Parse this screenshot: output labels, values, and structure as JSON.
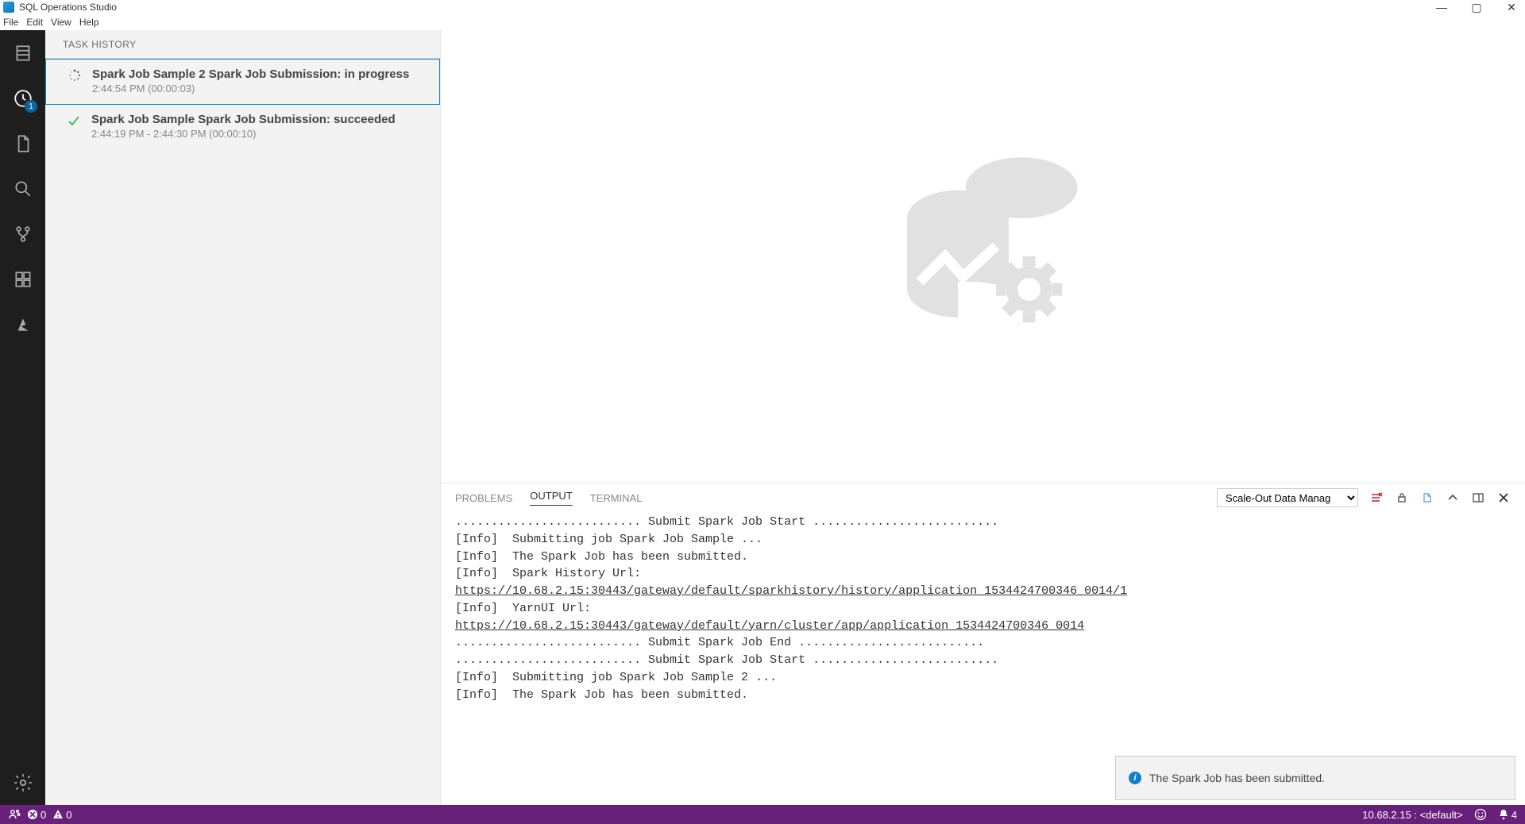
{
  "window": {
    "title": "SQL Operations Studio"
  },
  "menubar": [
    "File",
    "Edit",
    "View",
    "Help"
  ],
  "activitybar": {
    "items": [
      {
        "name": "servers",
        "active": false
      },
      {
        "name": "task-history",
        "active": true,
        "badge": "1"
      },
      {
        "name": "explorer",
        "active": false
      },
      {
        "name": "search",
        "active": false
      },
      {
        "name": "source-control",
        "active": false
      },
      {
        "name": "extensions",
        "active": false
      },
      {
        "name": "azure",
        "active": false
      }
    ]
  },
  "sidebar": {
    "title": "TASK HISTORY",
    "tasks": [
      {
        "status": "in-progress",
        "title": "Spark Job Sample 2 Spark Job Submission: in progress",
        "time": "2:44:54 PM (00:00:03)",
        "selected": true
      },
      {
        "status": "succeeded",
        "title": "Spark Job Sample Spark Job Submission: succeeded",
        "time": "2:44:19 PM - 2:44:30 PM (00:00:10)",
        "selected": false
      }
    ]
  },
  "panel": {
    "tabs": {
      "problems": "PROBLEMS",
      "output": "OUTPUT",
      "terminal": "TERMINAL"
    },
    "activeTab": "output",
    "outputSource": "Scale-Out Data Manag",
    "output": {
      "lines": [
        ".......................... Submit Spark Job Start ..........................",
        "[Info]  Submitting job Spark Job Sample ...",
        "[Info]  The Spark Job has been submitted.",
        "[Info]  Spark History Url:",
        "https://10.68.2.15:30443/gateway/default/sparkhistory/history/application_1534424700346_0014/1",
        "[Info]  YarnUI Url:",
        "https://10.68.2.15:30443/gateway/default/yarn/cluster/app/application_1534424700346_0014",
        ".......................... Submit Spark Job End ..........................",
        ".......................... Submit Spark Job Start ..........................",
        "[Info]  Submitting job Spark Job Sample 2 ...",
        "[Info]  The Spark Job has been submitted."
      ],
      "urlLineIndices": [
        4,
        6
      ]
    }
  },
  "toast": {
    "message": "The Spark Job has been submitted."
  },
  "statusbar": {
    "errors": "0",
    "warnings": "0",
    "connection": "10.68.2.15 : <default>",
    "notifications": "4"
  }
}
